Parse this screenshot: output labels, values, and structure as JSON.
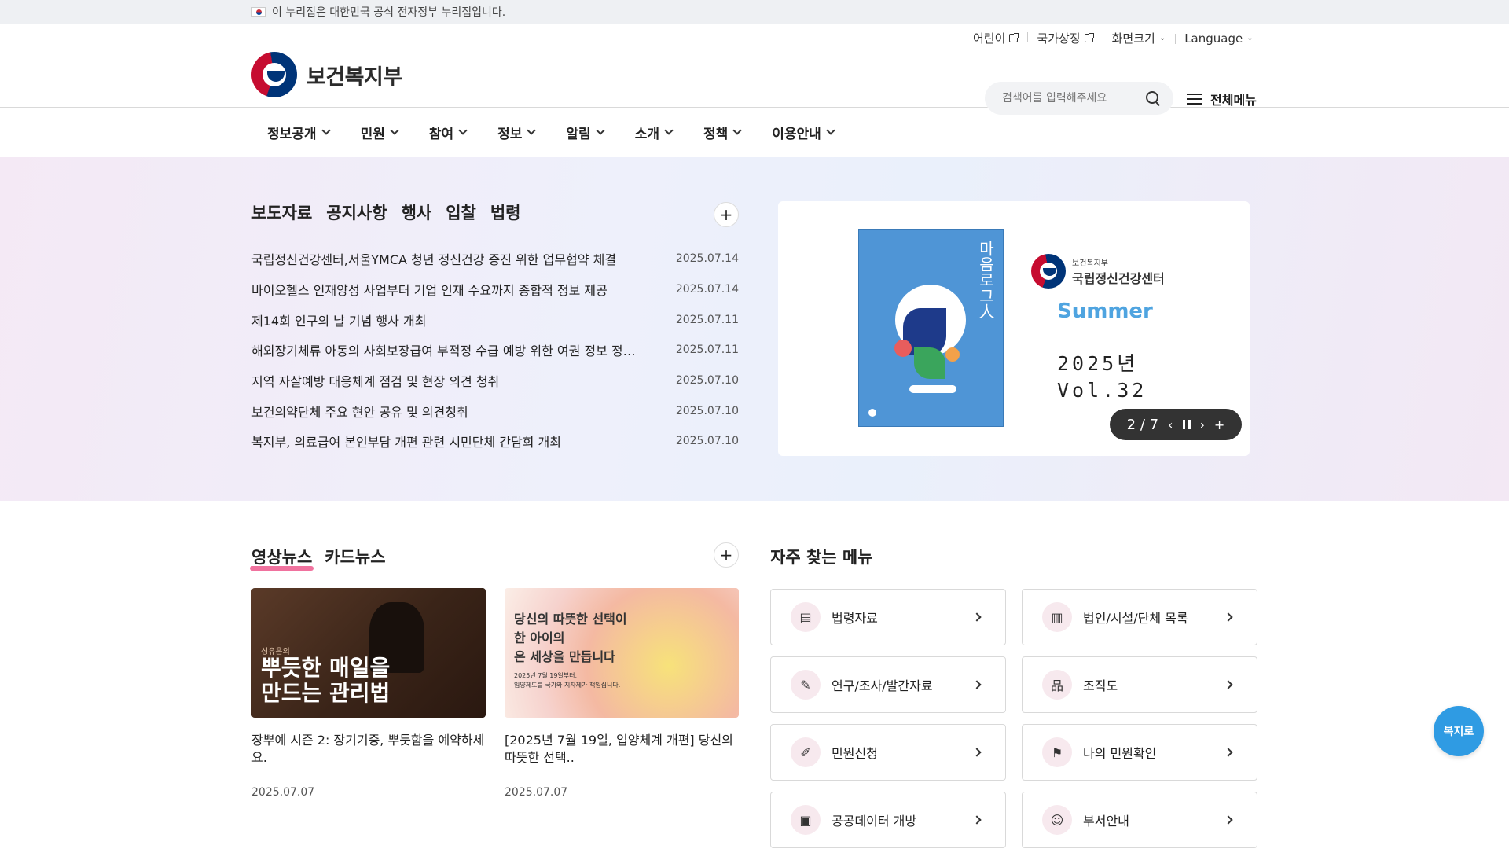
{
  "gov_banner": {
    "text": "이 누리집은 대한민국 공식 전자정부 누리집입니다."
  },
  "util_links": [
    {
      "label": "어린이",
      "icon": "external-link-icon"
    },
    {
      "label": "국가상징",
      "icon": "external-link-icon"
    },
    {
      "label": "화면크기",
      "icon": "chevron-down-icon"
    },
    {
      "label": "Language",
      "icon": "chevron-down-icon"
    }
  ],
  "logo": {
    "text": "보건복지부"
  },
  "search": {
    "placeholder": "검색어를 입력해주세요"
  },
  "all_menu": {
    "label": "전체메뉴"
  },
  "gnb": [
    "정보공개",
    "민원",
    "참여",
    "정보",
    "알림",
    "소개",
    "정책",
    "이용안내"
  ],
  "news_tabs": [
    "보도자료",
    "공지사항",
    "행사",
    "입찰",
    "법령"
  ],
  "news": [
    {
      "title": "국립정신건강센터,서울YMCA 청년 정신건강 증진 위한 업무협약 체결",
      "date": "2025.07.14"
    },
    {
      "title": "바이오헬스 인재양성 사업부터 기업 인재 수요까지 종합적 정보 제공",
      "date": "2025.07.14"
    },
    {
      "title": "제14회 인구의 날 기념 행사 개최",
      "date": "2025.07.11"
    },
    {
      "title": "해외장기체류 아동의 사회보장급여 부적정 수급 예방 위한 여권 정보 정비...",
      "date": "2025.07.11"
    },
    {
      "title": "지역 자살예방 대응체계 점검 및 현장 의견 청취",
      "date": "2025.07.10"
    },
    {
      "title": "보건의약단체 주요 현안 공유 및 의견청취",
      "date": "2025.07.10"
    },
    {
      "title": "복지부, 의료급여 본인부담 개편 관련 시민단체 간담회 개최",
      "date": "2025.07.10"
    }
  ],
  "banner": {
    "magazine_title": "마음로그人",
    "org_small": "보건복지부",
    "org_name": "국립정신건강센터",
    "season": "Summer",
    "year": "2025년",
    "vol": "Vol.32",
    "counter": "2 / 7"
  },
  "media_tabs": [
    "영상뉴스",
    "카드뉴스"
  ],
  "videos": [
    {
      "thumb_small": "성유은의",
      "thumb_line1": "뿌듯한 매일을",
      "thumb_line2": "만드는 관리법",
      "title": "장뿌예 시즌 2: 장기기증, 뿌듯함을 예약하세요.",
      "date": "2025.07.07"
    },
    {
      "thumb_line1": "당신의 따뜻한 선택이",
      "thumb_line2": "한 아이의",
      "thumb_line3": "온 세상을 만듭니다",
      "thumb_small1": "2025년 7월 19일부터,",
      "thumb_small2": "입양제도를 국가와 지자체가 책임집니다.",
      "title": "[2025년 7월 19일, 입양체계 개편] 당신의 따뜻한 선택..",
      "date": "2025.07.07"
    }
  ],
  "fav_title": "자주 찾는 메뉴",
  "favorites": [
    {
      "label": "법령자료",
      "icon": "law-book-icon",
      "glyph": "▤"
    },
    {
      "label": "법인/시설/단체 목록",
      "icon": "building-list-icon",
      "glyph": "▥"
    },
    {
      "label": "연구/조사/발간자료",
      "icon": "research-doc-icon",
      "glyph": "✎"
    },
    {
      "label": "조직도",
      "icon": "org-chart-icon",
      "glyph": "品"
    },
    {
      "label": "민원신청",
      "icon": "pen-document-icon",
      "glyph": "✐"
    },
    {
      "label": "나의 민원확인",
      "icon": "flag-icon",
      "glyph": "⚑"
    },
    {
      "label": "공공데이터 개방",
      "icon": "data-folder-icon",
      "glyph": "▣"
    },
    {
      "label": "부서안내",
      "icon": "people-icon",
      "glyph": "☺"
    }
  ],
  "chatbot": {
    "label": "복지로"
  },
  "colors": {
    "accent_pink": "#ec4f86",
    "chatbot_blue": "#2f9be3",
    "slider_bg": "#333333"
  }
}
